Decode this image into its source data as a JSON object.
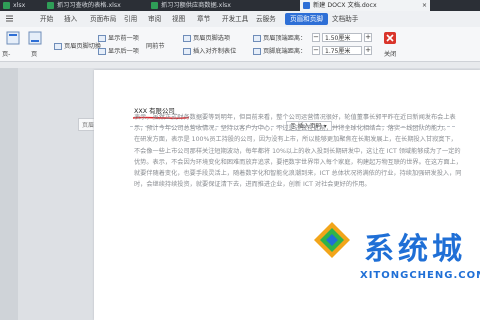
{
  "tabs": [
    {
      "label": "xlsx",
      "color": "#2f9e57"
    },
    {
      "label": "抓习习查收的表格.xlsx",
      "color": "#2f9e57"
    },
    {
      "label": "抓习习额供应商数据.xlsx",
      "color": "#2f9e57"
    },
    {
      "label": "新建 DOCX 文档.docx",
      "color": "#2e6fd6",
      "active": true
    }
  ],
  "menu": {
    "items": [
      "开始",
      "插入",
      "页面布局",
      "引用",
      "审阅",
      "视图",
      "章节",
      "开发工具",
      "云服务",
      "页眉和页脚",
      "文档助手"
    ],
    "active_index": 9
  },
  "ribbon": {
    "left_label": "页-",
    "left_label2": "页",
    "same_as_prev": "页眉页脚切换",
    "show_prev": "显示前一项",
    "show_next": "显示后一项",
    "link_prev": "同前节",
    "header_top_label": "页眉顶端距离：",
    "footer_bottom_label": "页脚底端距离：",
    "header_top_value": "1.50厘米",
    "footer_bottom_value": "1.75厘米",
    "insert_align_tab": "插入对齐制表位",
    "page_options": "页眉页脚选项",
    "close": "关闭"
  },
  "doc": {
    "margin_tag": "页眉",
    "header_text": "XXX 有限公司",
    "insert_page_number": "插入页码",
    "paragraphs": [
      "表示，虽然正式财务数据要等到明年，但目前来看，整个公司运营情况很好，轮值董事长郭平昨在近日新闻发布会上表示，预计今年公司总营收情况，坚持以客户为中心，不过是过去在此前，并将全球化相结合，落实一线团队的能力。",
      "在研发方面，表示是 100%员工持股的公司，因为没有上市，所以能够更加聚焦在长期发展上，在长期投入甘寂寞下，不会像一些上市公司那样关注短期波动，每年都将 10%以上的收入投到长期研发中，这让在 ICT 领域能够成为了一定的优势。表示，不会因为环境变化和困难而放弃追求，要把数字世界带入每个家庭，构建起万物互联的世界。在这方面上，就要伴随着变化，也要手段灵活上，随着数字化和智能化浪潮到来，ICT 总体状况将满依的行业，持续加强研发投入，同时，会继续持续投资，就要保证清下去，进而推进企业，创新 ICT 对社会更好的作用。"
    ]
  },
  "watermark": {
    "text": "系统城",
    "url": "XITONGCHENG.COM",
    "color": "#1f6fd6"
  },
  "colors": {
    "accent": "#2e6fd6",
    "tabbar": "#2b2f36",
    "excel_green": "#2f9e57"
  }
}
